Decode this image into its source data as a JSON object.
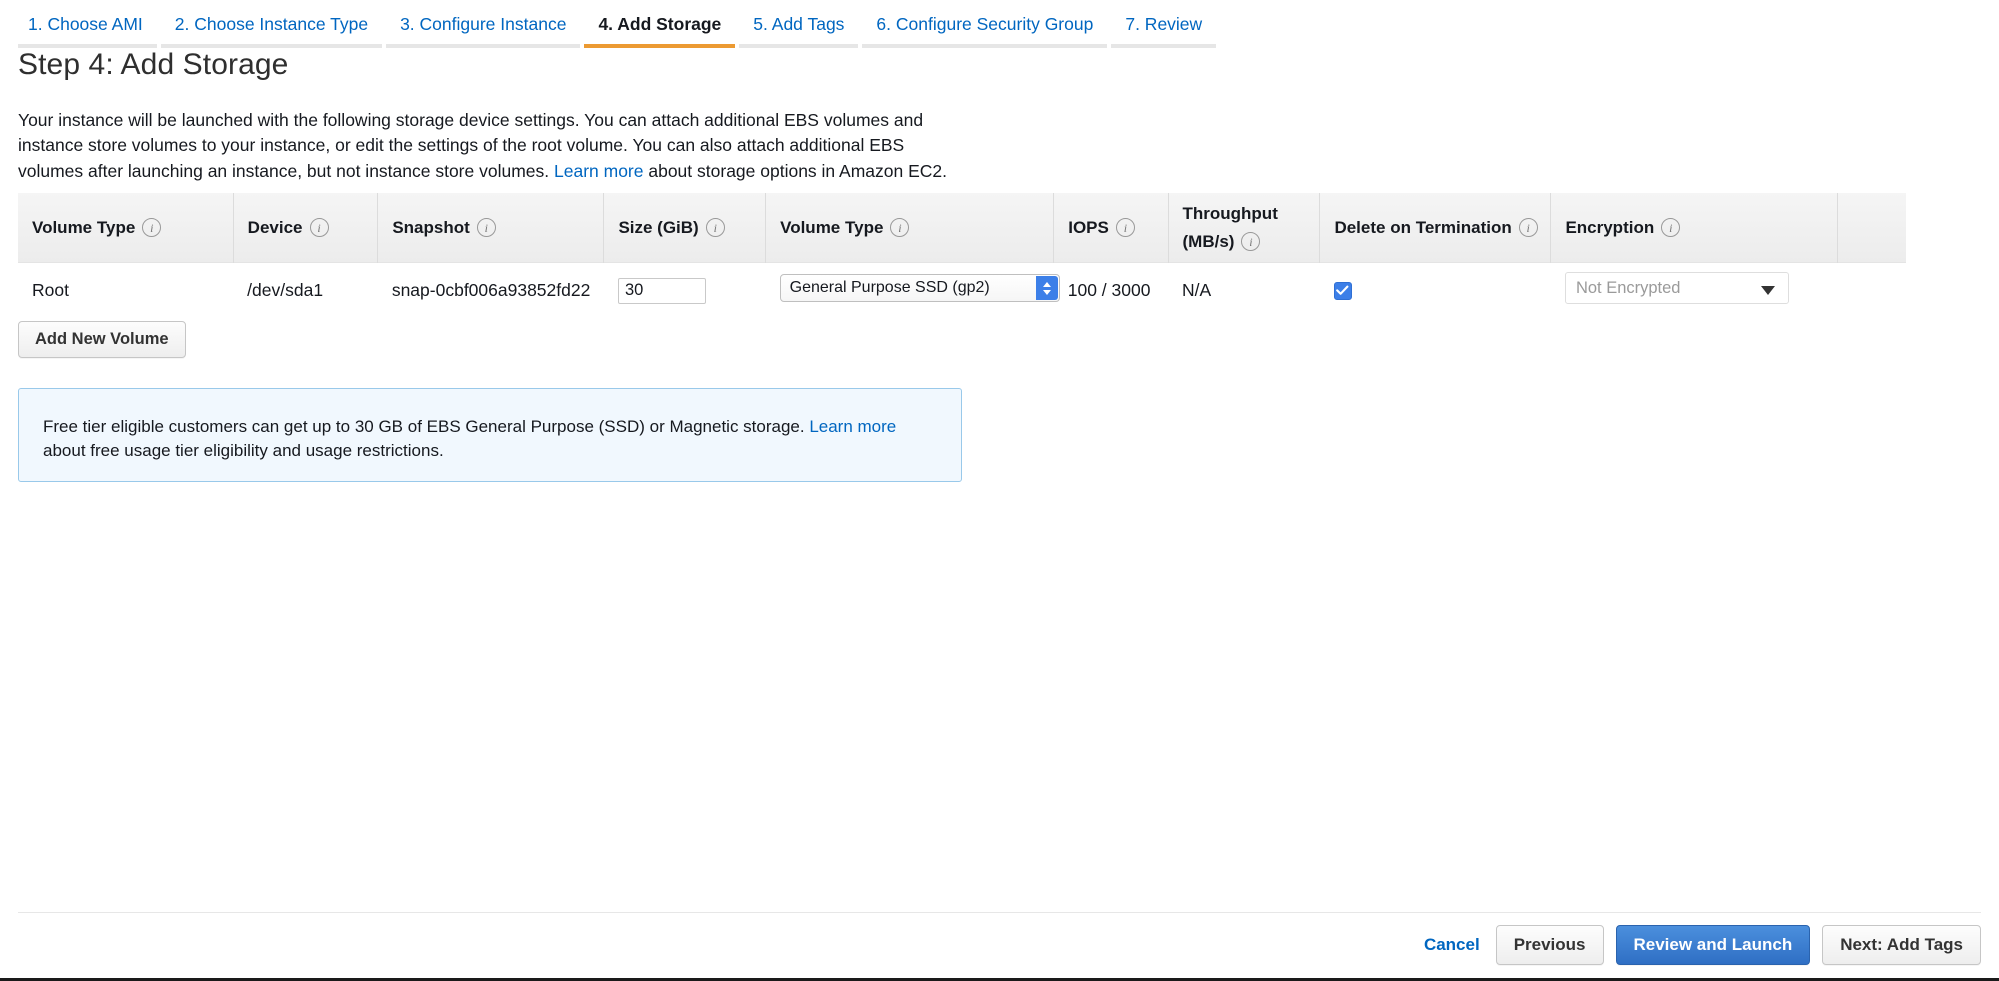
{
  "wizard": {
    "tabs": [
      {
        "label": "1. Choose AMI",
        "active": false
      },
      {
        "label": "2. Choose Instance Type",
        "active": false
      },
      {
        "label": "3. Configure Instance",
        "active": false
      },
      {
        "label": "4. Add Storage",
        "active": true
      },
      {
        "label": "5. Add Tags",
        "active": false
      },
      {
        "label": "6. Configure Security Group",
        "active": false
      },
      {
        "label": "7. Review",
        "active": false
      }
    ]
  },
  "page": {
    "title": "Step 4: Add Storage",
    "intro_part1": "Your instance will be launched with the following storage device settings. You can attach additional EBS volumes and instance store volumes to your instance, or edit the settings of the root volume. You can also attach additional EBS volumes after launching an instance, but not instance store volumes. ",
    "intro_link": "Learn more",
    "intro_part2": " about storage options in Amazon EC2."
  },
  "table": {
    "headers": [
      {
        "label": "Volume Type",
        "info": "info-icon"
      },
      {
        "label": "Device",
        "info": "info-icon"
      },
      {
        "label": "Snapshot",
        "info": "info-icon"
      },
      {
        "label": "Size (GiB)",
        "info": "info-icon"
      },
      {
        "label": "Volume Type",
        "info": "info-icon"
      },
      {
        "label": "IOPS",
        "info": "info-icon"
      },
      {
        "label": "Throughput (MB/s)",
        "info": "info-icon"
      },
      {
        "label": "Delete on Termination",
        "info": "info-icon"
      },
      {
        "label": "Encryption",
        "info": "info-icon"
      }
    ],
    "header_throughput_line1": "Throughput",
    "header_throughput_line2": "(MB/s)",
    "rows": [
      {
        "volume_type": "Root",
        "device": "/dev/sda1",
        "snapshot": "snap-0cbf006a93852fd22",
        "size": "30",
        "volume_type_select": "General Purpose SSD (gp2)",
        "iops": "100 / 3000",
        "throughput": "N/A",
        "delete_on_termination": true,
        "encryption": "Not Encrypted"
      }
    ]
  },
  "actions": {
    "add_new_volume": "Add New Volume",
    "cancel": "Cancel",
    "previous": "Previous",
    "review_and_launch": "Review and Launch",
    "next": "Next: Add Tags"
  },
  "info_box": {
    "text_part1": "Free tier eligible customers can get up to 30 GB of EBS General Purpose (SSD) or Magnetic storage. ",
    "link": "Learn more",
    "text_part2": " about free usage tier eligibility and usage restrictions."
  },
  "colors": {
    "link": "#0066c0",
    "active_tab_underline": "#ec9a32",
    "primary_button": "#2f6fc4",
    "checkbox": "#3c7fe8",
    "info_box_bg": "#f1f8fe",
    "info_box_border": "#99c9ea"
  }
}
